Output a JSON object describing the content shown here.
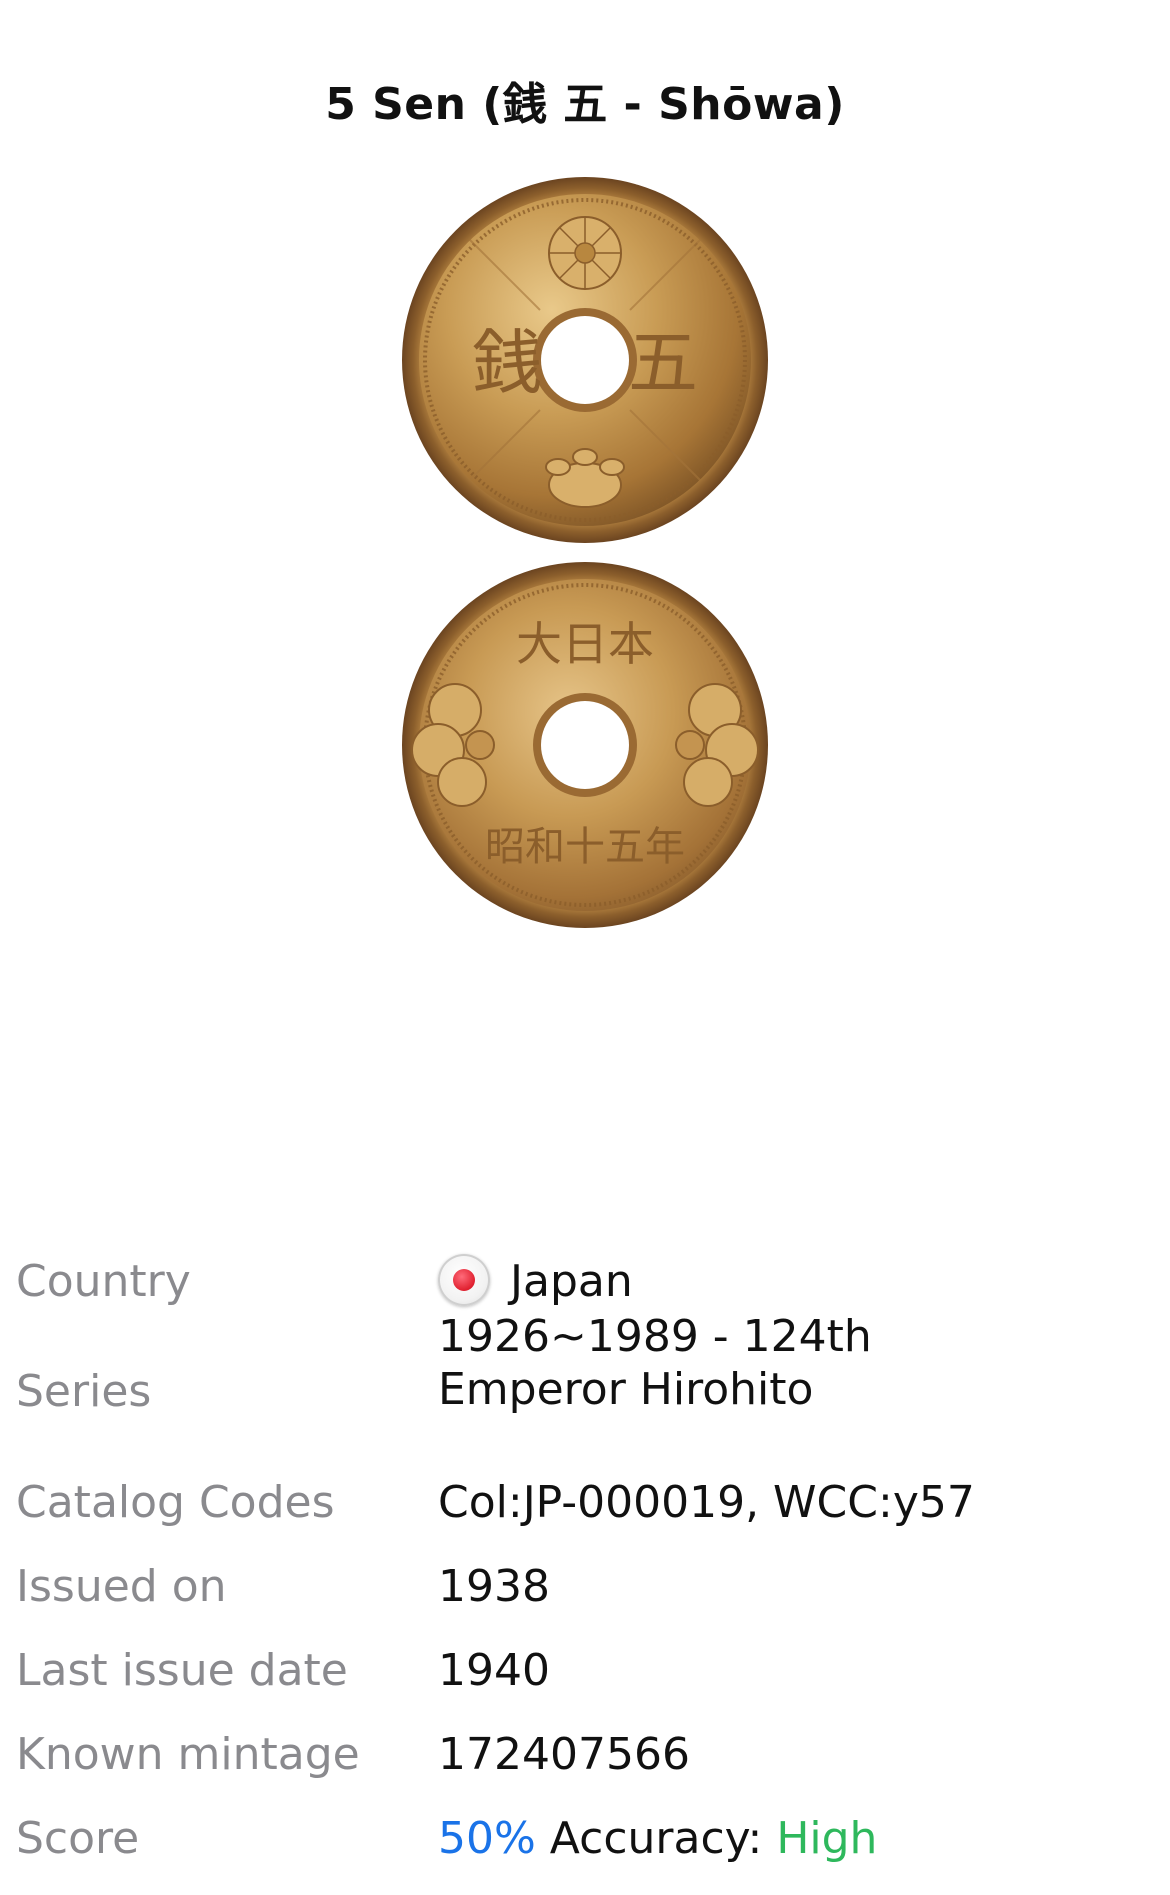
{
  "header": {
    "title": "5 Sen (銭 五 - Shōwa)"
  },
  "coin_images": {
    "obverse": {
      "left_char": "銭",
      "right_char": "五"
    },
    "reverse": {
      "top_chars": "大日本",
      "bottom_chars": "昭和十五年"
    }
  },
  "details": {
    "country": {
      "label": "Country",
      "value": "Japan",
      "flag_icon": "japan-flag-icon"
    },
    "series": {
      "label": "Series",
      "value_line1": "1926~1989 - 124th",
      "value_line2": "Emperor Hirohito"
    },
    "catalog_codes": {
      "label": "Catalog Codes",
      "value": "Col:JP-000019, WCC:y57"
    },
    "issued_on": {
      "label": "Issued on",
      "value": "1938"
    },
    "last_issue_date": {
      "label": "Last issue date",
      "value": "1940"
    },
    "known_mintage": {
      "label": "Known mintage",
      "value": "172407566"
    },
    "score": {
      "label": "Score",
      "percent": "50%",
      "accuracy_label": "Accuracy:",
      "accuracy_value": "High"
    }
  },
  "colors": {
    "label_gray": "#8a8a8e",
    "score_blue": "#1a73e8",
    "accuracy_green": "#2eb85c",
    "coin_gold": "#c79a4e"
  }
}
